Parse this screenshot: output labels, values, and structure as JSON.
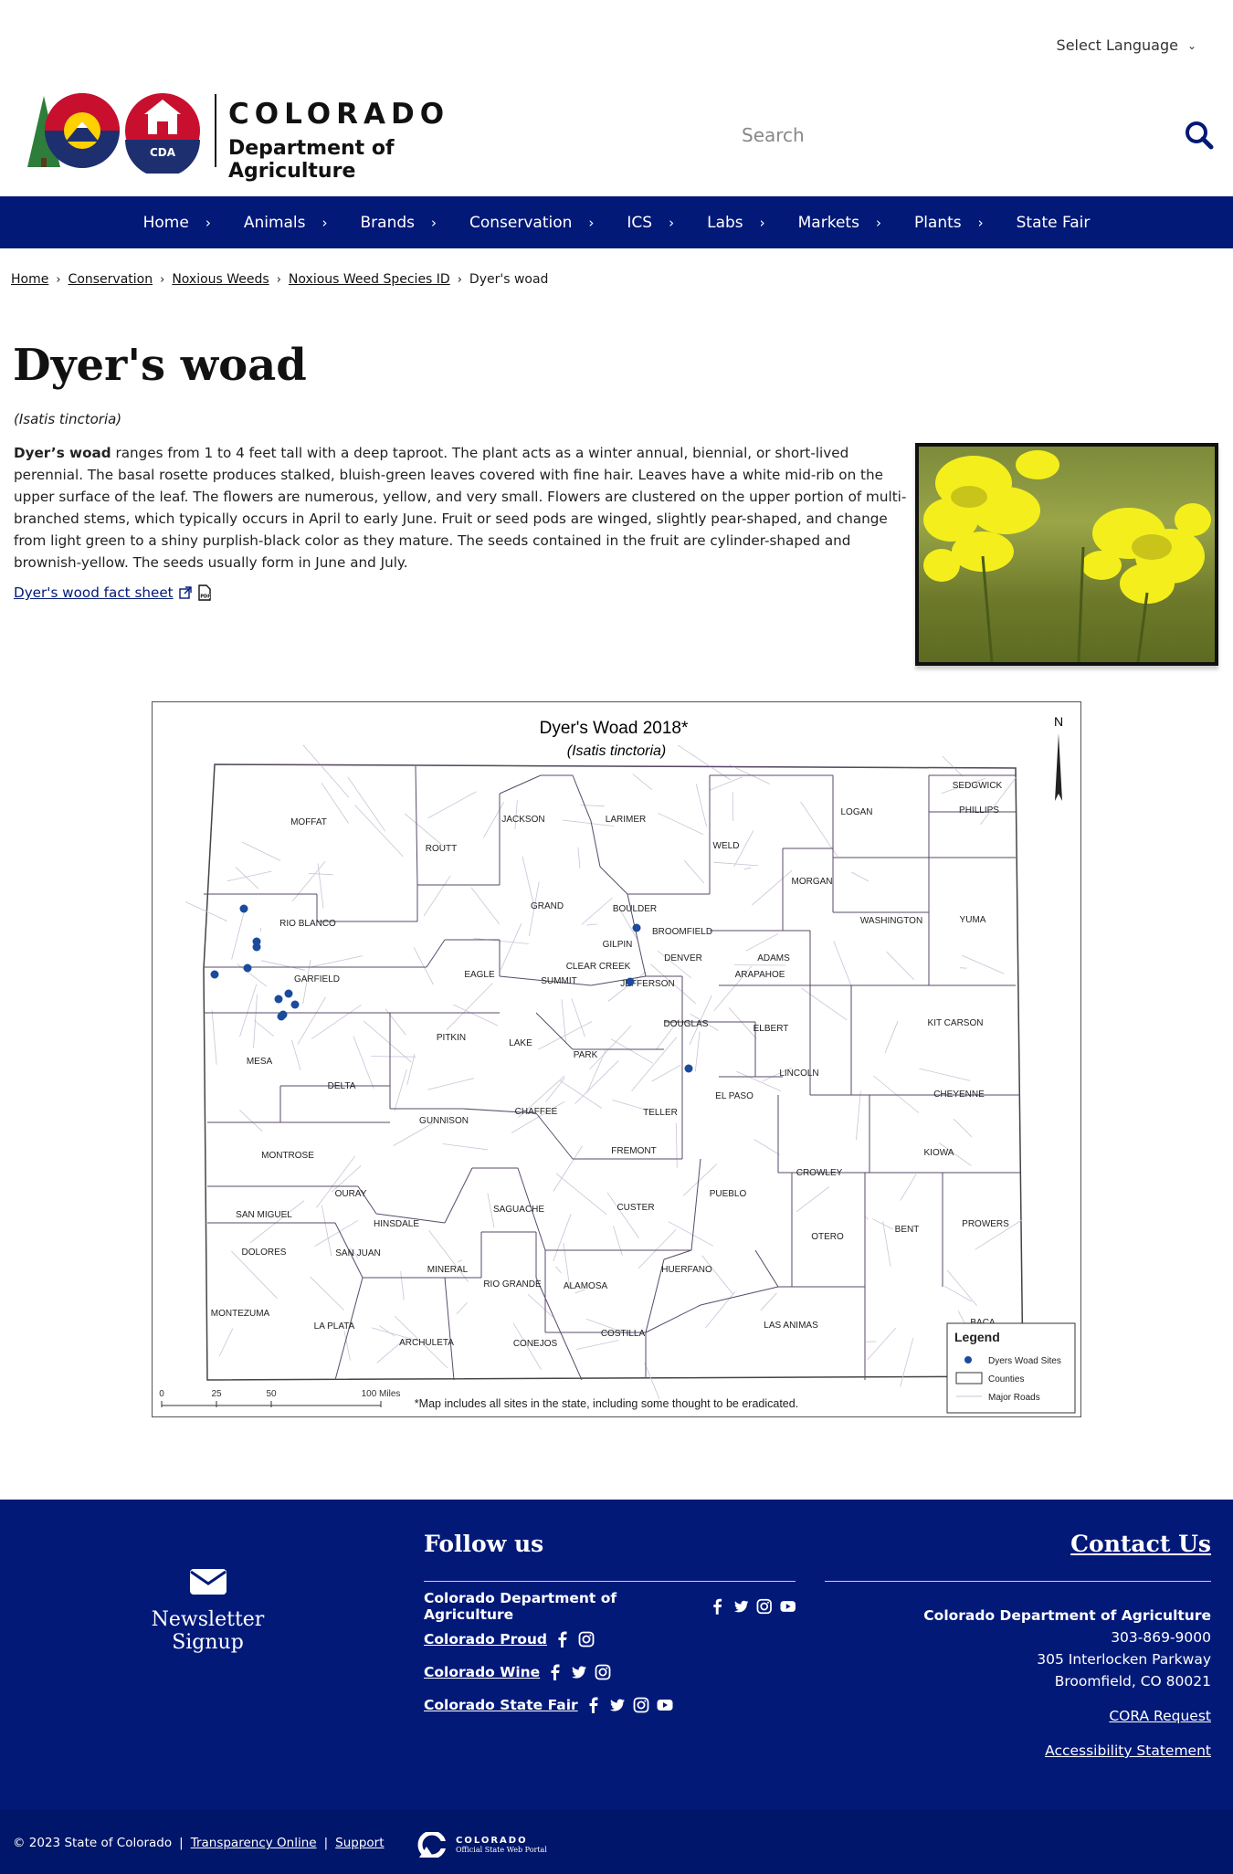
{
  "language": {
    "label": "Select Language"
  },
  "header": {
    "logo_line1": "COLORADO",
    "logo_line2": "Department of Agriculture",
    "logo_badge": "CDA",
    "search_placeholder": "Search"
  },
  "nav": {
    "items": [
      {
        "label": "Home"
      },
      {
        "label": "Animals"
      },
      {
        "label": "Brands"
      },
      {
        "label": "Conservation"
      },
      {
        "label": "ICS"
      },
      {
        "label": "Labs"
      },
      {
        "label": "Markets"
      },
      {
        "label": "Plants"
      },
      {
        "label": "State Fair"
      }
    ]
  },
  "breadcrumb": {
    "items": [
      "Home",
      "Conservation",
      "Noxious Weeds",
      "Noxious Weed Species ID"
    ],
    "current": "Dyer's woad"
  },
  "page": {
    "title": "Dyer's woad",
    "scientific_name": "(Isatis tinctoria)",
    "desc_lead": "Dyer’s woad",
    "desc_body": " ranges from 1 to 4 feet tall with a deep taproot. The plant acts as a winter annual, biennial, or short-lived perennial. The basal rosette produces stalked, bluish-green leaves covered with fine hair. Leaves have a white mid-rib on the upper surface of the leaf. The flowers are numerous, yellow, and very small. Flowers are clustered on the upper portion of multi-branched stems, which typically occurs in April to early June. Fruit or seed pods are winged, slightly pear-shaped, and change from light green to a shiny purplish-black color as they mature. The seeds contained in the fruit are cylinder-shaped and brownish-yellow. The seeds usually form in June and July.",
    "factsheet_link": "Dyer's wood fact sheet"
  },
  "map": {
    "title": "Dyer's Woad 2018*",
    "subtitle": "(Isatis tinctoria)",
    "north": "N",
    "footnote": "*Map includes all sites in the state, including some thought to be eradicated.",
    "scale_labels": [
      "0",
      "25",
      "50",
      "100 Miles"
    ],
    "legend": {
      "title": "Legend",
      "items": [
        "Dyers Woad Sites",
        "Counties",
        "Major Roads"
      ]
    },
    "counties": [
      "MOFFAT",
      "ROUTT",
      "JACKSON",
      "LARIMER",
      "WELD",
      "LOGAN",
      "SEDGWICK",
      "PHILLIPS",
      "MORGAN",
      "RIO BLANCO",
      "GRAND",
      "BOULDER",
      "BROOMFIELD",
      "WASHINGTON",
      "YUMA",
      "GILPIN",
      "DENVER",
      "ADAMS",
      "CLEAR CREEK",
      "EAGLE",
      "SUMMIT",
      "JEFFERSON",
      "ARAPAHOE",
      "GARFIELD",
      "DOUGLAS",
      "ELBERT",
      "KIT CARSON",
      "PITKIN",
      "LAKE",
      "PARK",
      "MESA",
      "LINCOLN",
      "DELTA",
      "EL PASO",
      "CHEYENNE",
      "GUNNISON",
      "CHAFFEE",
      "TELLER",
      "MONTROSE",
      "FREMONT",
      "KIOWA",
      "CROWLEY",
      "OURAY",
      "PUEBLO",
      "SAN MIGUEL",
      "HINSDALE",
      "SAGUACHE",
      "CUSTER",
      "BENT",
      "PROWERS",
      "OTERO",
      "DOLORES",
      "SAN JUAN",
      "MINERAL",
      "RIO GRANDE",
      "ALAMOSA",
      "HUERFANO",
      "MONTEZUMA",
      "LA PLATA",
      "ARCHULETA",
      "CONEJOS",
      "COSTILLA",
      "LAS ANIMAS",
      "BACA"
    ],
    "dot_color": "#1a4b9c"
  },
  "footer": {
    "newsletter": "Newsletter Signup",
    "follow_title": "Follow us",
    "social": [
      {
        "label": "Colorado Department of Agriculture",
        "linked": false
      },
      {
        "label": "Colorado Proud",
        "linked": true
      },
      {
        "label": "Colorado Wine",
        "linked": true
      },
      {
        "label": "Colorado State Fair",
        "linked": true
      }
    ],
    "contact_title": "Contact Us",
    "org": "Colorado Department of Agriculture",
    "phone": "303-869-9000",
    "address1": "305 Interlocken Parkway",
    "address2": "Broomfield, CO 80021",
    "cora": "CORA Request",
    "accessibility": "Accessibility Statement"
  },
  "bottom": {
    "copyright": "© 2023 State of Colorado",
    "sep": "|",
    "transparency": "Transparency Online",
    "support": "Support",
    "portal1": "COLORADO",
    "portal2": "Official State Web Portal"
  },
  "colors": {
    "nav": "#021978",
    "footer": "#021978",
    "bottom": "#00166a"
  }
}
